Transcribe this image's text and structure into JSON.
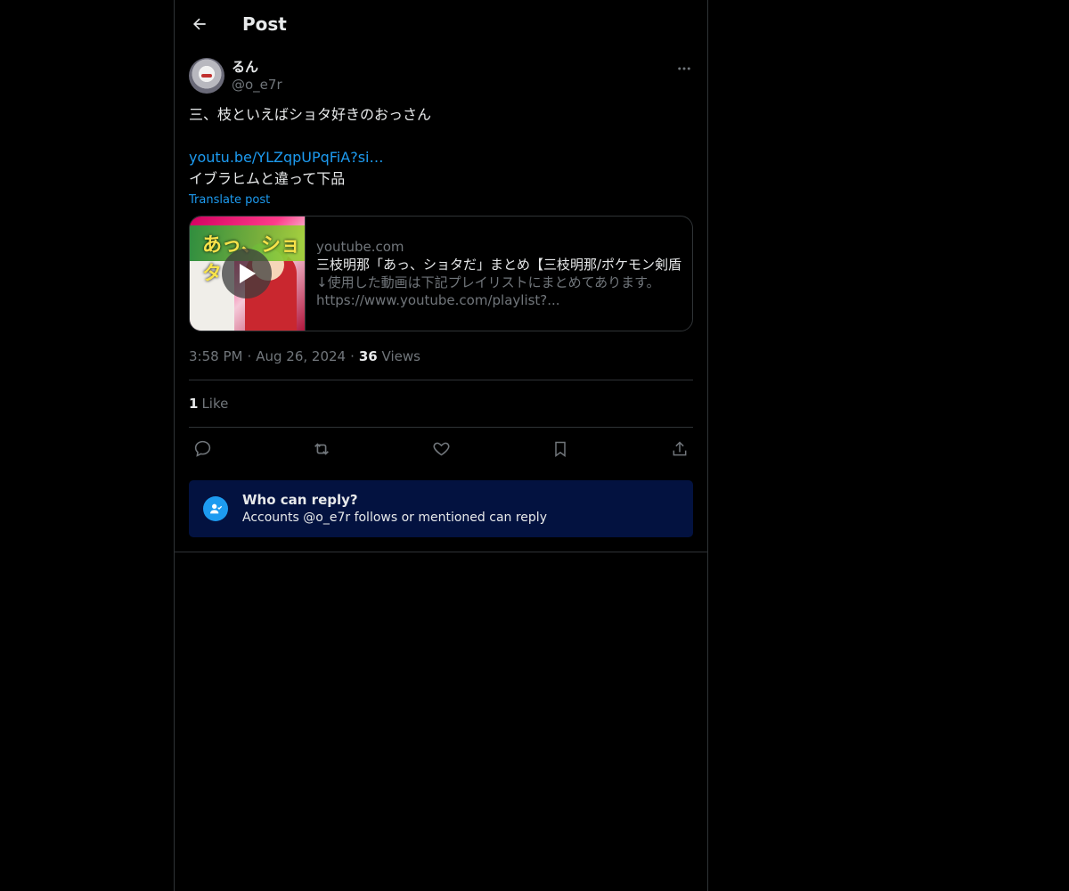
{
  "header": {
    "title": "Post",
    "back_icon": "arrow-left-icon"
  },
  "author": {
    "display_name": "るん",
    "handle": "@o_e7r"
  },
  "post": {
    "line1": "三、枝といえばショタ好きのおっさん",
    "link_text": "youtu.be/YLZqpUPqFiA?si…",
    "line3": "イブラヒムと違って下品",
    "translate_label": "Translate post"
  },
  "card": {
    "domain": "youtube.com",
    "title": "三枝明那「あっ、ショタだ」まとめ【三枝明那/ポケモン剣盾",
    "desc1": "↓使用した動画は下記プレイリストにまとめてあります。",
    "desc2": "https://www.youtube.com/playlist?...",
    "thumb_text": "あっ、ショタ"
  },
  "meta": {
    "time": "3:58 PM",
    "date": "Aug 26, 2024",
    "views_count": "36",
    "views_label": "Views"
  },
  "stats": {
    "likes_count": "1",
    "likes_label": "Like"
  },
  "reply_restriction": {
    "title": "Who can reply?",
    "subtitle": "Accounts @o_e7r follows or mentioned can reply"
  },
  "colors": {
    "accent": "#1d9bf0",
    "background": "#000000",
    "border": "#2f3336",
    "muted": "#71767b",
    "reply_box": "#031240"
  }
}
